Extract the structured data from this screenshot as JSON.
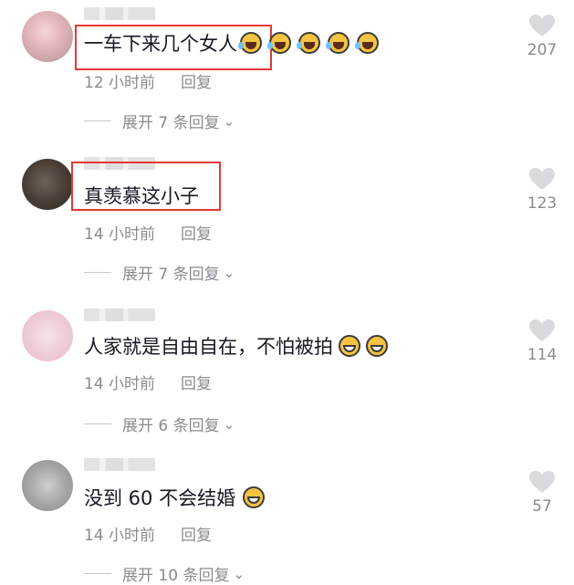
{
  "comments": [
    {
      "text": "一车下来几个女人",
      "emojis": [
        "laugh-cry-emoji",
        "laugh-cry-emoji",
        "laugh-cry-emoji",
        "laugh-cry-emoji",
        "laugh-cry-emoji"
      ],
      "time": "12 小时前",
      "reply": "回复",
      "expand": "展开 7 条回复",
      "likes": "207"
    },
    {
      "text": "真羡慕这小子",
      "emojis": [],
      "time": "14 小时前",
      "reply": "回复",
      "expand": "展开 7 条回复",
      "likes": "123"
    },
    {
      "text": "人家就是自由自在，不怕被拍",
      "emojis": [
        "grin-emoji",
        "grin-emoji"
      ],
      "time": "14 小时前",
      "reply": "回复",
      "expand": "展开 6 条回复",
      "likes": "114"
    },
    {
      "text": "没到 60 不会结婚",
      "emojis": [
        "grin-emoji"
      ],
      "time": "14 小时前",
      "reply": "回复",
      "expand": "展开 10 条回复",
      "likes": "57"
    }
  ],
  "colors": {
    "highlight": "#e53935",
    "meta": "#8a8b91",
    "heart": "#d9d9de"
  },
  "icons": {
    "like": "heart-icon",
    "expand": "chevron-down-icon"
  }
}
